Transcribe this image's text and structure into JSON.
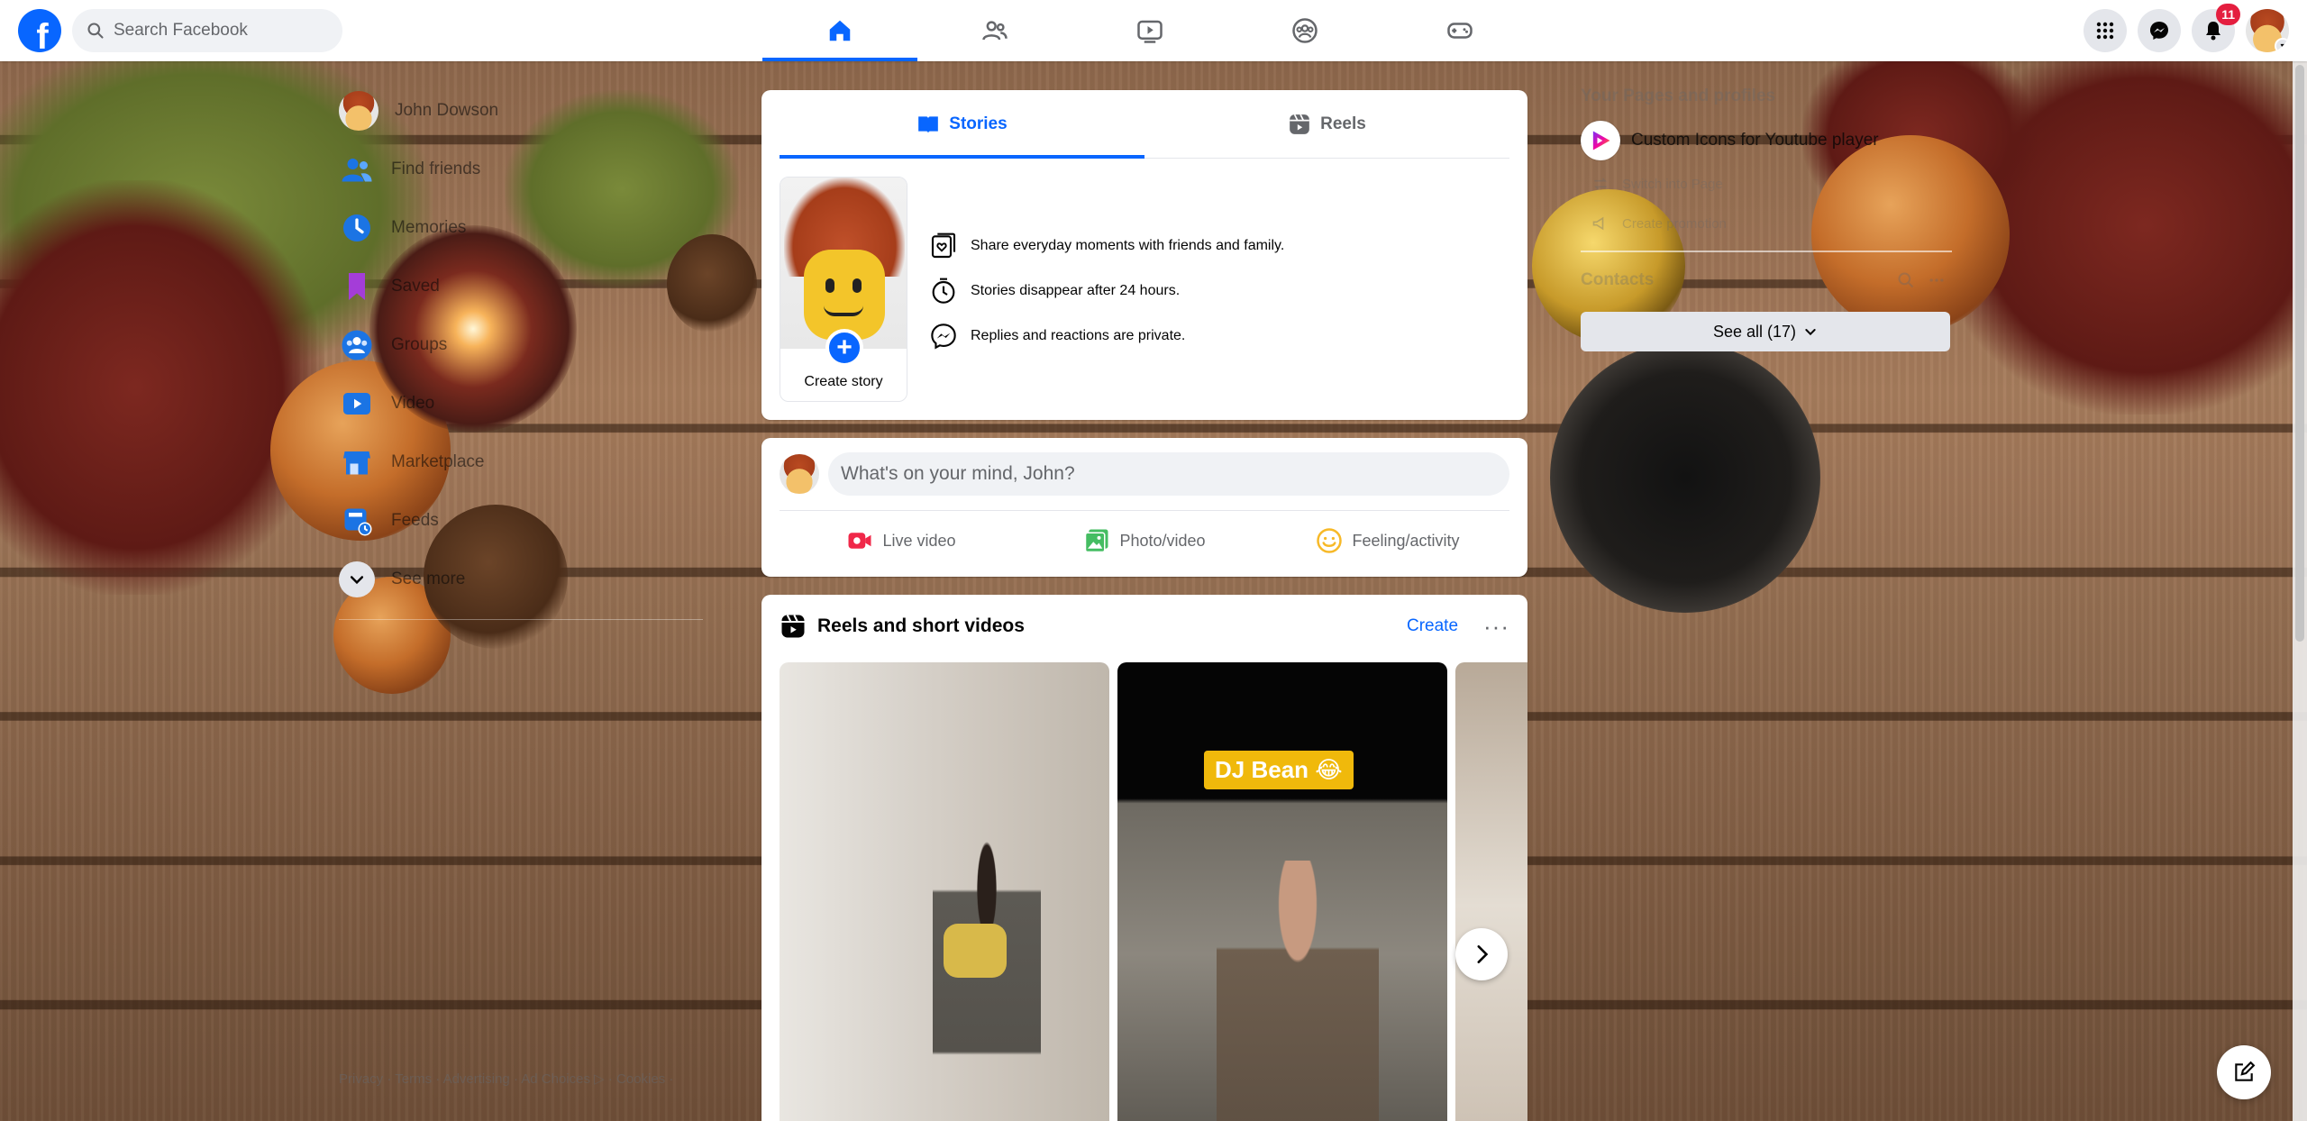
{
  "header": {
    "logo": "f",
    "search": {
      "placeholder": "Search Facebook"
    },
    "notifications_count": "11",
    "nav_tabs": [
      {
        "id": "home",
        "icon": "home-icon",
        "active": true
      },
      {
        "id": "friends",
        "icon": "friends-icon",
        "active": false
      },
      {
        "id": "video",
        "icon": "video-icon",
        "active": false
      },
      {
        "id": "groups",
        "icon": "groups-icon",
        "active": false
      },
      {
        "id": "gaming",
        "icon": "gaming-icon",
        "active": false
      }
    ]
  },
  "sidebar": {
    "items": [
      {
        "label": "John Dowson",
        "icon": "avatar"
      },
      {
        "label": "Find friends",
        "icon": "friends-icon"
      },
      {
        "label": "Memories",
        "icon": "clock-icon"
      },
      {
        "label": "Saved",
        "icon": "bookmark-icon"
      },
      {
        "label": "Groups",
        "icon": "groups-icon"
      },
      {
        "label": "Video",
        "icon": "video-icon"
      },
      {
        "label": "Marketplace",
        "icon": "marketplace-icon"
      },
      {
        "label": "Feeds",
        "icon": "feeds-icon"
      },
      {
        "label": "See more",
        "icon": "chevron-down-icon"
      }
    ],
    "footer": "Privacy · Terms · Advertising · Ad Choices ▷ · Cookies ·"
  },
  "stories": {
    "tabs": [
      {
        "label": "Stories",
        "active": true
      },
      {
        "label": "Reels",
        "active": false
      }
    ],
    "create_label": "Create story",
    "info": [
      "Share everyday moments with friends and family.",
      "Stories disappear after 24 hours.",
      "Replies and reactions are private."
    ]
  },
  "composer": {
    "placeholder": "What's on your mind, John?",
    "actions": [
      {
        "label": "Live video",
        "color": "#f02849"
      },
      {
        "label": "Photo/video",
        "color": "#45bd62"
      },
      {
        "label": "Feeling/activity",
        "color": "#f7b928"
      }
    ]
  },
  "reels": {
    "title": "Reels and short videos",
    "create_label": "Create",
    "more_label": "···",
    "tiles": [
      {
        "tag": ""
      },
      {
        "tag": "DJ Bean 😂"
      },
      {
        "tag": ""
      }
    ]
  },
  "right": {
    "pages_heading": "Your Pages and profiles",
    "page_name": "Custom Icons for Youtube player",
    "page_actions": [
      "Switch into Page",
      "Create promotion"
    ],
    "contacts_heading": "Contacts",
    "see_all_label": "See all (17)"
  },
  "colors": {
    "brand": "#0866ff",
    "badge": "#e41e3f"
  }
}
